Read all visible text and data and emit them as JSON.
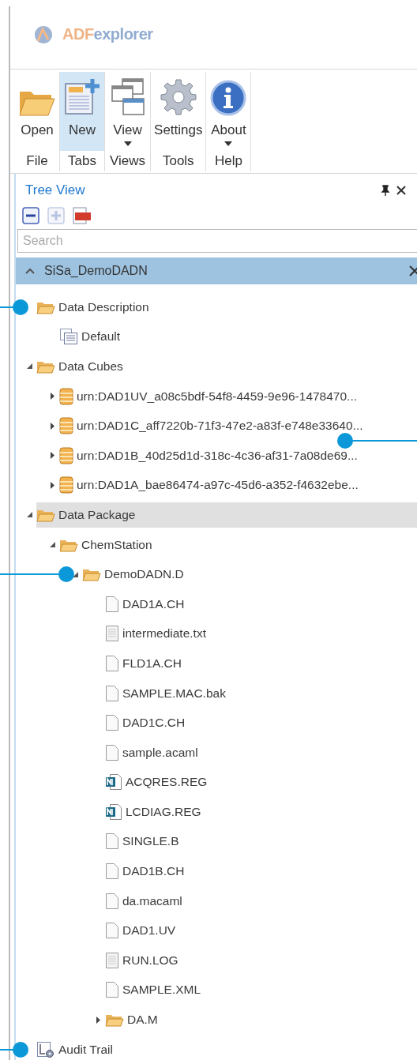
{
  "app": {
    "logo_text_a": "ADF",
    "logo_text_b": "explorer"
  },
  "ribbon": {
    "groups": [
      {
        "label": "File",
        "buttons": [
          {
            "label": "Open",
            "kind": "open",
            "dropdown": false,
            "selected": false
          }
        ]
      },
      {
        "label": "Tabs",
        "buttons": [
          {
            "label": "New",
            "kind": "new",
            "dropdown": false,
            "selected": true
          }
        ]
      },
      {
        "label": "Views",
        "buttons": [
          {
            "label": "View",
            "kind": "view",
            "dropdown": true,
            "selected": false
          }
        ]
      },
      {
        "label": "Tools",
        "buttons": [
          {
            "label": "Settings",
            "kind": "settings",
            "dropdown": false,
            "selected": false
          }
        ]
      },
      {
        "label": "Help",
        "buttons": [
          {
            "label": "About",
            "kind": "about",
            "dropdown": true,
            "selected": false
          }
        ]
      }
    ]
  },
  "panel": {
    "title": "Tree View",
    "search": {
      "placeholder": "Search"
    },
    "file_header": {
      "title": "SiSa_DemoDADN",
      "expanded": true
    },
    "tree": [
      {
        "label": "Data Description",
        "kind": "folder",
        "selected": false,
        "left_callout": true,
        "children": [
          {
            "label": "Default",
            "kind": "table",
            "selected": false
          }
        ]
      },
      {
        "label": "Data Cubes",
        "kind": "folder",
        "expanded": true,
        "selected": false,
        "children": [
          {
            "label": "urn:DAD1UV_a08c5bdf-54f8-4459-9e96-1478470...",
            "kind": "database",
            "expanded": false,
            "selected": false
          },
          {
            "label": "urn:DAD1C_aff7220b-71f3-47e2-a83f-e748e33640...",
            "kind": "database",
            "expanded": false,
            "selected": false,
            "right_callout": true
          },
          {
            "label": "urn:DAD1B_40d25d1d-318c-4c36-af31-7a08de69...",
            "kind": "database",
            "expanded": false,
            "selected": false
          },
          {
            "label": "urn:DAD1A_bae86474-a97c-45d6-a352-f4632ebe...",
            "kind": "database",
            "expanded": false,
            "selected": false
          }
        ]
      },
      {
        "label": "Data Package",
        "kind": "folder",
        "expanded": true,
        "selected": true,
        "children": [
          {
            "label": "ChemStation",
            "kind": "folder",
            "expanded": true,
            "selected": false,
            "children": [
              {
                "label": "DemoDADN.D",
                "kind": "folder",
                "expanded": true,
                "selected": false,
                "left_callout": true,
                "children": [
                  {
                    "label": "DAD1A.CH",
                    "kind": "document",
                    "selected": false
                  },
                  {
                    "label": "intermediate.txt",
                    "kind": "text",
                    "selected": false
                  },
                  {
                    "label": "FLD1A.CH",
                    "kind": "document",
                    "selected": false
                  },
                  {
                    "label": "SAMPLE.MAC.bak",
                    "kind": "document",
                    "selected": false
                  },
                  {
                    "label": "DAD1C.CH",
                    "kind": "document",
                    "selected": false
                  },
                  {
                    "label": "sample.acaml",
                    "kind": "document",
                    "selected": false
                  },
                  {
                    "label": "ACQRES.REG",
                    "kind": "registry",
                    "selected": false
                  },
                  {
                    "label": "LCDIAG.REG",
                    "kind": "registry",
                    "selected": false
                  },
                  {
                    "label": "SINGLE.B",
                    "kind": "document",
                    "selected": false
                  },
                  {
                    "label": "DAD1B.CH",
                    "kind": "document",
                    "selected": false
                  },
                  {
                    "label": "da.macaml",
                    "kind": "document",
                    "selected": false
                  },
                  {
                    "label": "DAD1.UV",
                    "kind": "document",
                    "selected": false
                  },
                  {
                    "label": "RUN.LOG",
                    "kind": "text",
                    "selected": false
                  },
                  {
                    "label": "SAMPLE.XML",
                    "kind": "document",
                    "selected": false
                  },
                  {
                    "label": "DA.M",
                    "kind": "folder",
                    "expanded": false,
                    "selected": false
                  }
                ]
              }
            ]
          }
        ]
      },
      {
        "label": "Audit Trail",
        "kind": "audit",
        "selected": false,
        "left_callout": true
      }
    ]
  }
}
